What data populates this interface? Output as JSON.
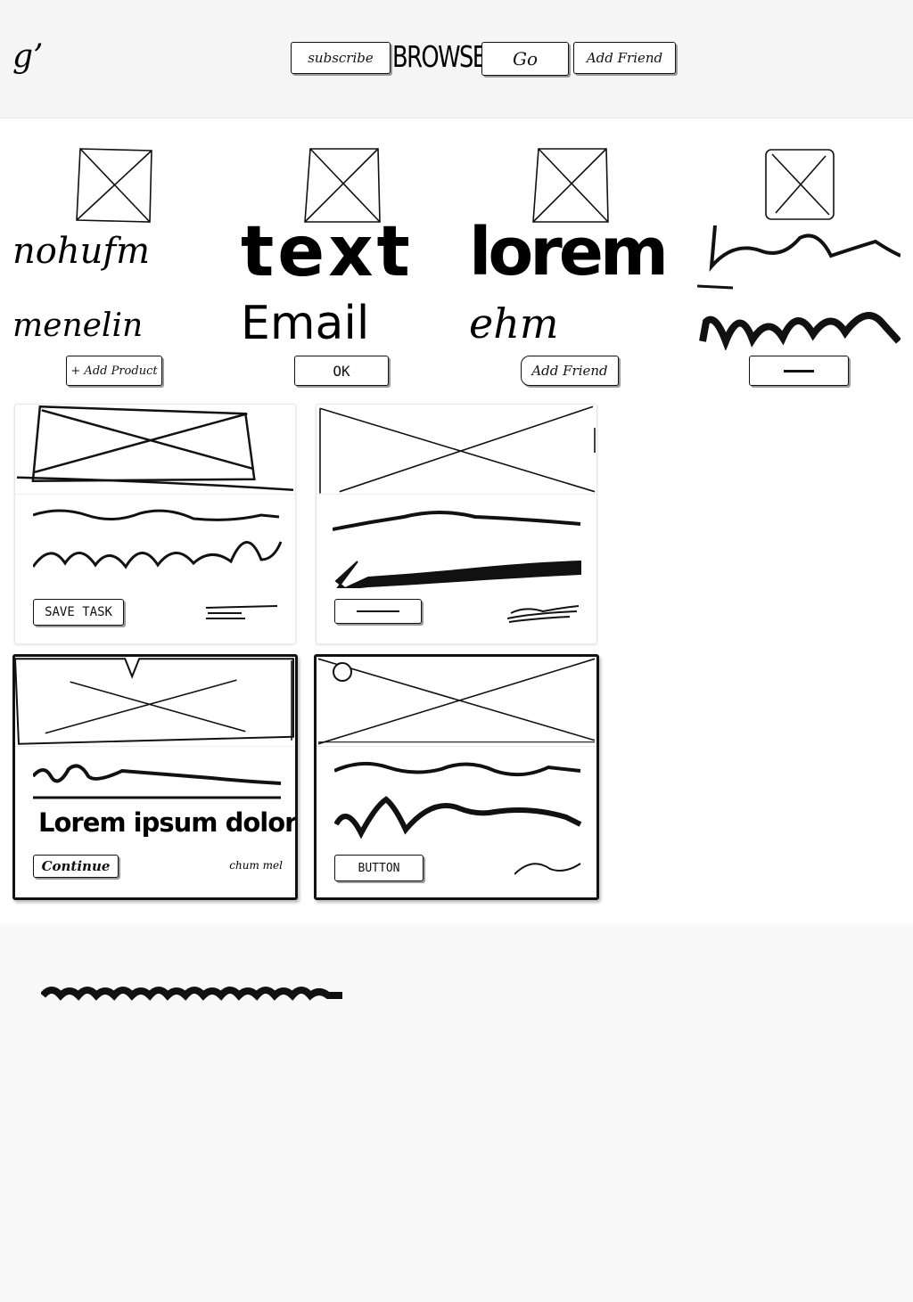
{
  "header": {
    "logo_text": "g’",
    "buttons": [
      {
        "label": "subscribe"
      },
      {
        "label": "BROWSE"
      },
      {
        "label": "Go"
      },
      {
        "label": "Add Friend"
      }
    ]
  },
  "products": [
    {
      "line1": "nohufm",
      "line2": "menelin",
      "button": "+ Add Product"
    },
    {
      "line1": "text",
      "line2": "Email",
      "button": "OK"
    },
    {
      "line1": "lorem",
      "line2": "ehm",
      "button": "Add Friend"
    },
    {
      "line1": "",
      "line2": "",
      "button": ""
    }
  ],
  "cards": [
    {
      "button": "SAVE TASK"
    },
    {
      "button": ""
    },
    {
      "heading": "Lorem ipsum dolor",
      "button": "Continue",
      "caption": "chum mel"
    },
    {
      "button": "BUTTON"
    }
  ],
  "colors": {
    "ink": "#111111",
    "header_bg": "#f5f5f5",
    "main_bg": "#ffffff",
    "footer_bg": "#f9f9f9"
  }
}
